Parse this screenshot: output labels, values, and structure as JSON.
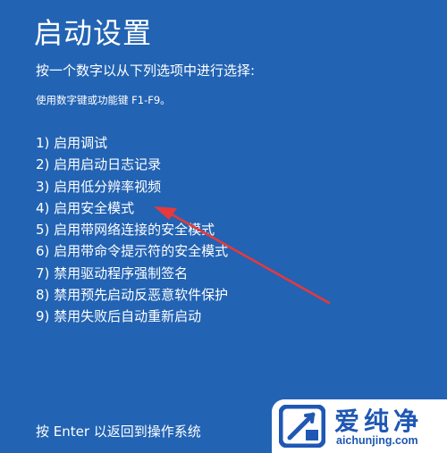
{
  "screen": {
    "title": "启动设置",
    "prompt": "按一个数字以从下列选项中进行选择:",
    "hint": "使用数字键或功能键 F1-F9。",
    "options": [
      {
        "label": "1) 启用调试"
      },
      {
        "label": "2) 启用启动日志记录"
      },
      {
        "label": "3) 启用低分辨率视频"
      },
      {
        "label": "4) 启用安全模式"
      },
      {
        "label": "5) 启用带网络连接的安全模式"
      },
      {
        "label": "6) 启用带命令提示符的安全模式"
      },
      {
        "label": "7) 禁用驱动程序强制签名"
      },
      {
        "label": "8) 禁用预先启动反恶意软件保护"
      },
      {
        "label": "9) 禁用失败后自动重新启动"
      }
    ],
    "footer": "按 Enter 以返回到操作系统"
  },
  "watermark": {
    "name": "爱纯净",
    "url": "aichunjing.com"
  },
  "colors": {
    "background": "#2263b3",
    "text": "#ffffff",
    "annotation_arrow": "#e5393d",
    "watermark_brand": "#1f57b4"
  }
}
